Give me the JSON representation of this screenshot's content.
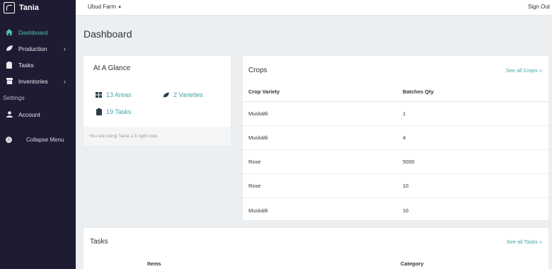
{
  "brand": {
    "name": "Tania"
  },
  "sidebar": {
    "items": [
      {
        "label": "Dashboard",
        "icon": "home-icon",
        "active": true
      },
      {
        "label": "Production",
        "icon": "leaf-icon",
        "has_submenu": true
      },
      {
        "label": "Tasks",
        "icon": "clipboard-icon"
      },
      {
        "label": "Inventories",
        "icon": "archive-icon",
        "has_submenu": true
      }
    ],
    "settings_label": "Settings",
    "account_label": "Account",
    "collapse_label": "Collapse Menu"
  },
  "topbar": {
    "farm": "Ubud Farm",
    "signout": "Sign Out"
  },
  "page": {
    "title": "Dashboard"
  },
  "glance": {
    "title": "At A Glance",
    "areas": "13 Areas",
    "varieties": "2 Varieties",
    "tasks": "19 Tasks",
    "footer": "You are using Tania 1.5 right now."
  },
  "crops": {
    "title": "Crops",
    "see_all": "See all Crops",
    "headers": [
      "Crop Variety",
      "Batches Qty"
    ],
    "rows": [
      [
        "Muskátli",
        "1"
      ],
      [
        "Muskátli",
        "4"
      ],
      [
        "Rose",
        "5000"
      ],
      [
        "Rose",
        "10"
      ],
      [
        "Muskátli",
        "10"
      ]
    ]
  },
  "tasks": {
    "title": "Tasks",
    "see_all": "See all Tasks",
    "headers": [
      "Items",
      "Category"
    ]
  },
  "colors": {
    "accent": "#3fa7a0",
    "sidebar_bg": "#1e1c33",
    "page_bg": "#eceff1"
  }
}
